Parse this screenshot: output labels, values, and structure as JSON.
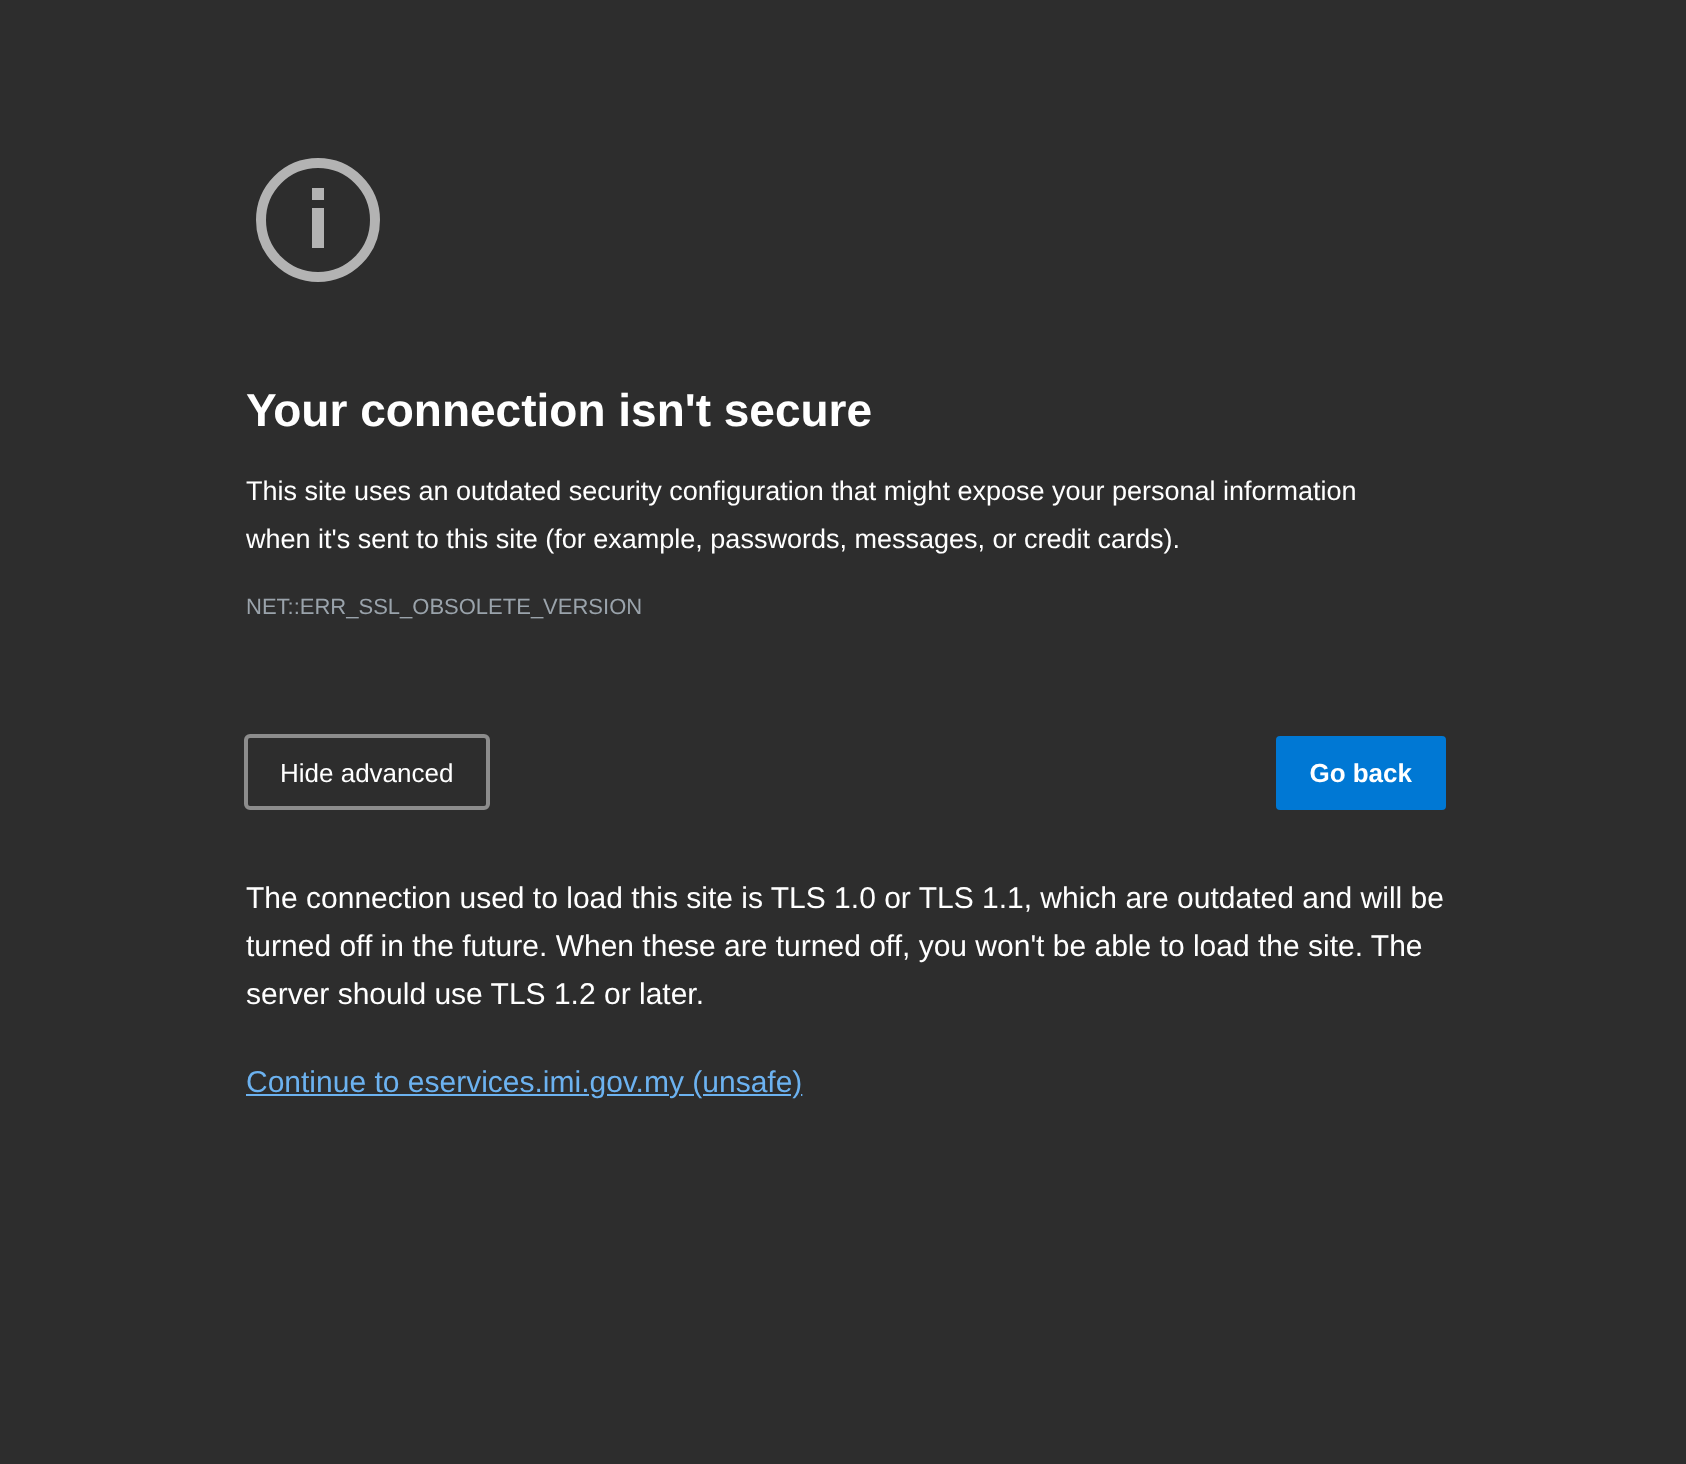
{
  "heading": "Your connection isn't secure",
  "description": "This site uses an outdated security configuration that might expose your personal information when it's sent to this site (for example, passwords, messages, or credit cards).",
  "error_code": "NET::ERR_SSL_OBSOLETE_VERSION",
  "buttons": [
    {
      "label": "Hide advanced",
      "kind": "secondary"
    },
    {
      "label": "Go back",
      "kind": "primary"
    }
  ],
  "advanced": {
    "text": "The connection used to load this site is TLS 1.0 or TLS 1.1, which are outdated and will be turned off in the future. When these are turned off, you won't be able to load the site. The server should use TLS 1.2 or later.",
    "link": "Continue to eservices.imi.gov.my (unsafe)"
  }
}
